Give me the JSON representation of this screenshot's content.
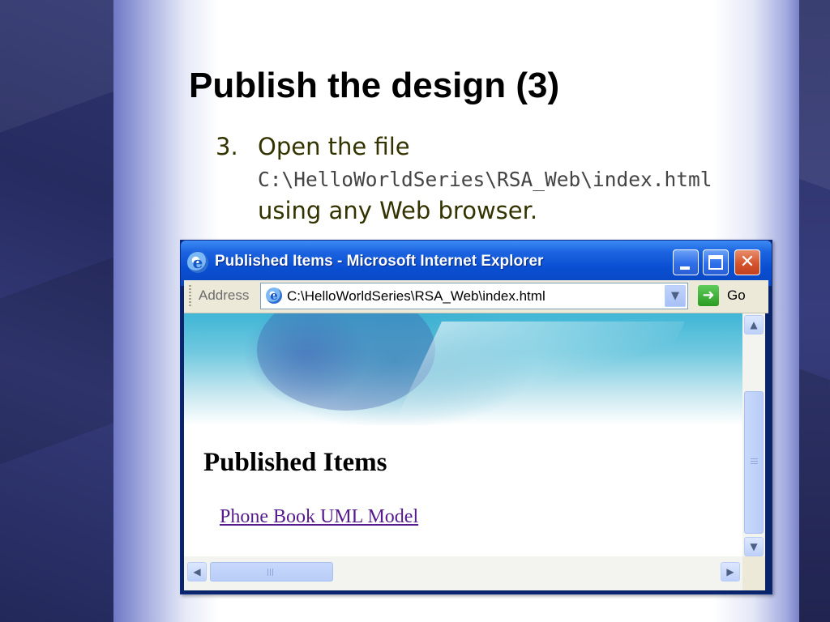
{
  "slide": {
    "title": "Publish the design (3)",
    "step_number": "3.",
    "step_text": "Open the file",
    "step_path": "C:\\HelloWorldSeries\\RSA_Web\\index.html",
    "step_suffix": " using any Web browser."
  },
  "browser": {
    "window_title": "Published Items - Microsoft Internet Explorer",
    "address_label": "Address",
    "address_value": "C:\\HelloWorldSeries\\RSA_Web\\index.html",
    "go_label": "Go",
    "icons": [
      "ie-icon",
      "minimize-icon",
      "maximize-icon",
      "close-icon",
      "page-icon",
      "chevron-down-icon",
      "go-arrow-icon",
      "scroll-up-icon",
      "scroll-down-icon",
      "scroll-left-icon",
      "scroll-right-icon"
    ]
  },
  "web_page": {
    "heading": "Published Items",
    "link_text": "Phone Book UML Model"
  },
  "colors": {
    "titlebar": "#0a4fd2",
    "close_button": "#d5532d",
    "visited_link": "#551a8b",
    "step_text": "#333300"
  }
}
